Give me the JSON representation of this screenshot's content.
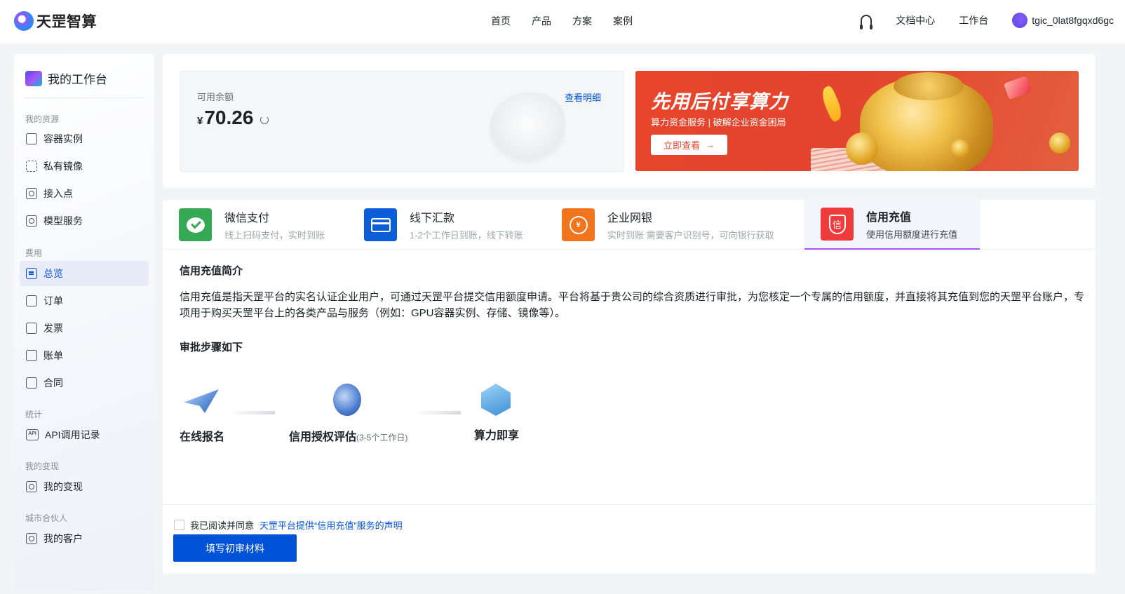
{
  "brand": {
    "name": "天罡智算"
  },
  "nav": {
    "items": [
      "首页",
      "产品",
      "方案",
      "案例"
    ],
    "docs": "文档中心",
    "workbench": "工作台",
    "username": "tgic_0lat8fgqxd6gc"
  },
  "sidebar": {
    "title": "我的工作台",
    "groups": [
      {
        "label": "我的资源",
        "items": [
          "容器实例",
          "私有镜像",
          "接入点",
          "模型服务"
        ]
      },
      {
        "label": "费用",
        "items": [
          "总览",
          "订单",
          "发票",
          "账单",
          "合同"
        ]
      },
      {
        "label": "统计",
        "items": [
          "API调用记录"
        ]
      },
      {
        "label": "我的变现",
        "items": [
          "我的变现"
        ]
      },
      {
        "label": "城市合伙人",
        "items": [
          "我的客户"
        ]
      }
    ],
    "active_item": "总览",
    "api_icon_text": "API"
  },
  "balance": {
    "label": "可用余额",
    "currency": "¥",
    "value": "70.26",
    "detail_link": "查看明细"
  },
  "banner": {
    "title": "先用后付享算力",
    "subtitle": "算力资金服务 | 破解企业资金困局",
    "button": "立即查看",
    "button_icon": "→"
  },
  "tabs": [
    {
      "title": "微信支付",
      "desc": "线上扫码支付，实时到账",
      "icon": "wechat-icon",
      "color": "#34a853"
    },
    {
      "title": "线下汇款",
      "desc": "1-2个工作日到账，线下转账",
      "icon": "card-icon",
      "color": "#0b5ed7"
    },
    {
      "title": "企业网银",
      "desc": "实时到账  需要客户识别号，可向银行获取",
      "icon": "bank-icon",
      "color": "#f2751e"
    },
    {
      "title": "信用充值",
      "desc": "使用信用额度进行充值",
      "icon": "credit-icon",
      "color": "#ef3b3b",
      "glyph": "信"
    }
  ],
  "active_tab": "信用充值",
  "content": {
    "intro_title": "信用充值简介",
    "intro_text": "信用充值是指天罡平台的实名认证企业用户，可通过天罡平台提交信用额度申请。平台将基于贵公司的综合资质进行审批，为您核定一个专属的信用额度，并直接将其充值到您的天罡平台账户，专项用于购买天罡平台上的各类产品与服务（例如：GPU容器实例、存储、镜像等）。",
    "steps_title": "审批步骤如下",
    "steps": [
      {
        "label": "在线报名",
        "note": ""
      },
      {
        "label": "信用授权评估",
        "note": "(3-5个工作日)"
      },
      {
        "label": "算力即享",
        "note": ""
      }
    ]
  },
  "footer": {
    "agree_prefix": "我已阅读并同意",
    "agree_link": "天罡平台提供“信用充值”服务的声明",
    "submit": "填写初审材料"
  },
  "colors": {
    "accent": "#0052d9",
    "banner": "#e4452e",
    "tab_underline": "#a855f7"
  }
}
